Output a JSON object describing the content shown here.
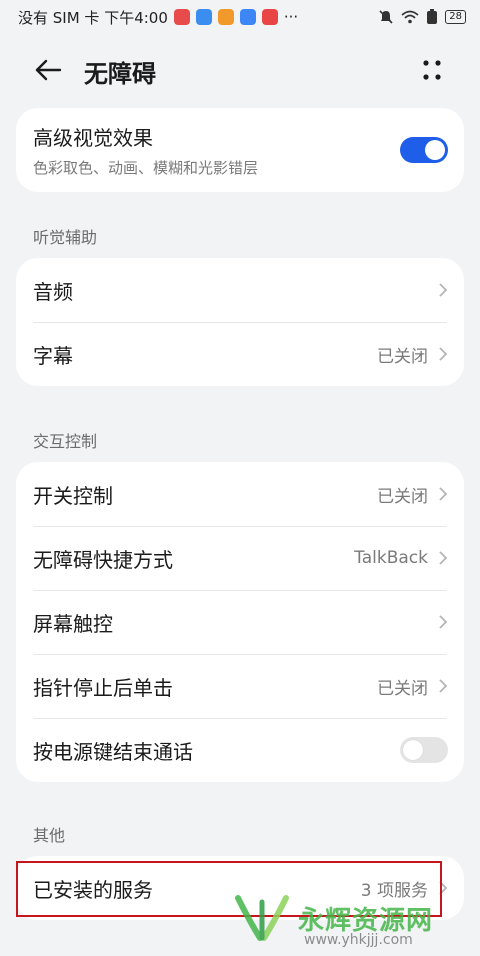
{
  "status_bar": {
    "left_text": "没有 SIM 卡 下午4:00",
    "more": "···",
    "battery": "28"
  },
  "header": {
    "title": "无障碍"
  },
  "vision": {
    "title": "高级视觉效果",
    "subtitle": "色彩取色、动画、模糊和光影错层",
    "toggle_on": true
  },
  "hearing": {
    "section": "听觉辅助",
    "items": [
      {
        "label": "音频",
        "value": ""
      },
      {
        "label": "字幕",
        "value": "已关闭"
      }
    ]
  },
  "interaction": {
    "section": "交互控制",
    "items": [
      {
        "label": "开关控制",
        "value": "已关闭"
      },
      {
        "label": "无障碍快捷方式",
        "value": "TalkBack"
      },
      {
        "label": "屏幕触控",
        "value": ""
      },
      {
        "label": "指针停止后单击",
        "value": "已关闭"
      },
      {
        "label": "按电源键结束通话",
        "value": ""
      }
    ]
  },
  "other": {
    "section": "其他",
    "items": [
      {
        "label": "已安装的服务",
        "value": "3 项服务"
      }
    ]
  },
  "watermark": {
    "brand": "永辉资源网",
    "url": "www.yhkjjj.com"
  },
  "colors": {
    "accent": "#1f5ee8",
    "highlight": "#c4161c",
    "watermark": "#45b649"
  }
}
